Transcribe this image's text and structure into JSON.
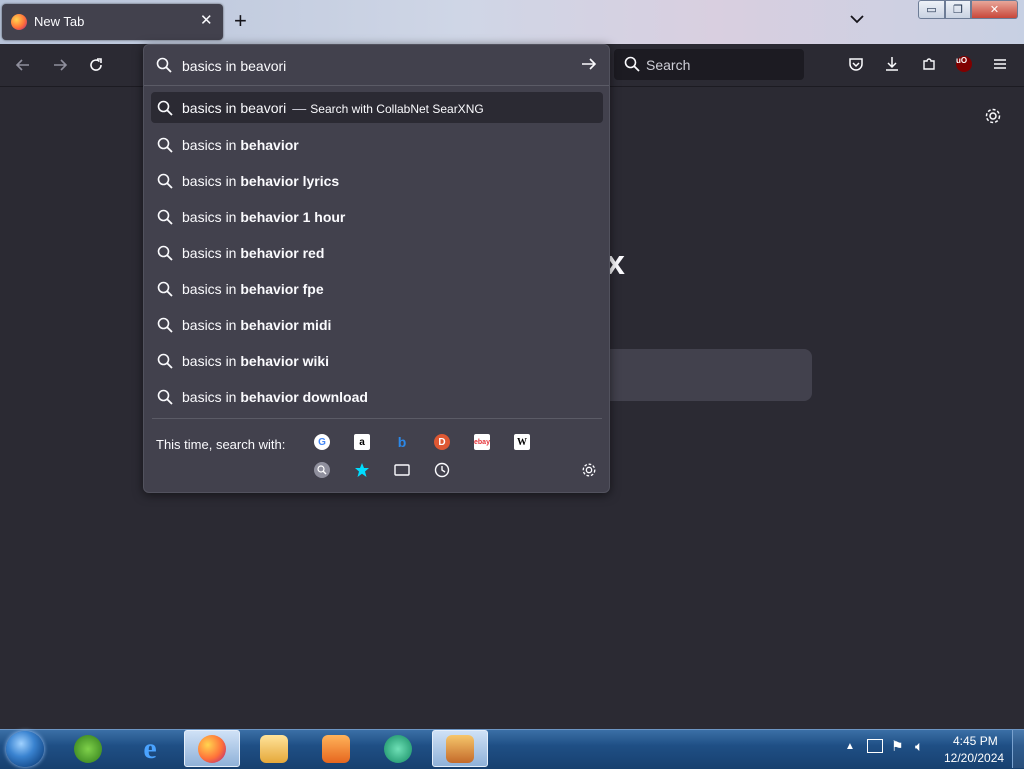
{
  "tab": {
    "title": "New Tab",
    "close": "✕"
  },
  "toolbar": {
    "new_tab": "+",
    "search_placeholder": "Search"
  },
  "window_buttons": {
    "minimize": "▭",
    "maximize": "❐",
    "close": "✕"
  },
  "urlbar": {
    "query": "basics in beavori",
    "suggestions": [
      {
        "prefix": "basics in beavori",
        "bold": "",
        "action": "Search with CollabNet SearXNG",
        "selected": true
      },
      {
        "prefix": "basics in ",
        "bold": "behavior"
      },
      {
        "prefix": "basics in ",
        "bold": "behavior lyrics"
      },
      {
        "prefix": "basics in ",
        "bold": "behavior 1 hour"
      },
      {
        "prefix": "basics in ",
        "bold": "behavior red"
      },
      {
        "prefix": "basics in ",
        "bold": "behavior fpe"
      },
      {
        "prefix": "basics in ",
        "bold": "behavior midi"
      },
      {
        "prefix": "basics in ",
        "bold": "behavior wiki"
      },
      {
        "prefix": "basics in ",
        "bold": "behavior download"
      }
    ],
    "oneoff_label": "This time, search with:",
    "engines": [
      "Google",
      "Amazon",
      "Bing",
      "DuckDuckGo",
      "eBay",
      "Wikipedia",
      "SearXNG",
      "Bookmarks",
      "Tabs",
      "History"
    ]
  },
  "newtab": {
    "logo_fragment": "x"
  },
  "taskbar": {
    "time": "4:45 PM",
    "date": "12/20/2024"
  },
  "colors": {
    "accent": "#42414d",
    "bg": "#2b2a33",
    "taskbar": "#1f4f85"
  }
}
